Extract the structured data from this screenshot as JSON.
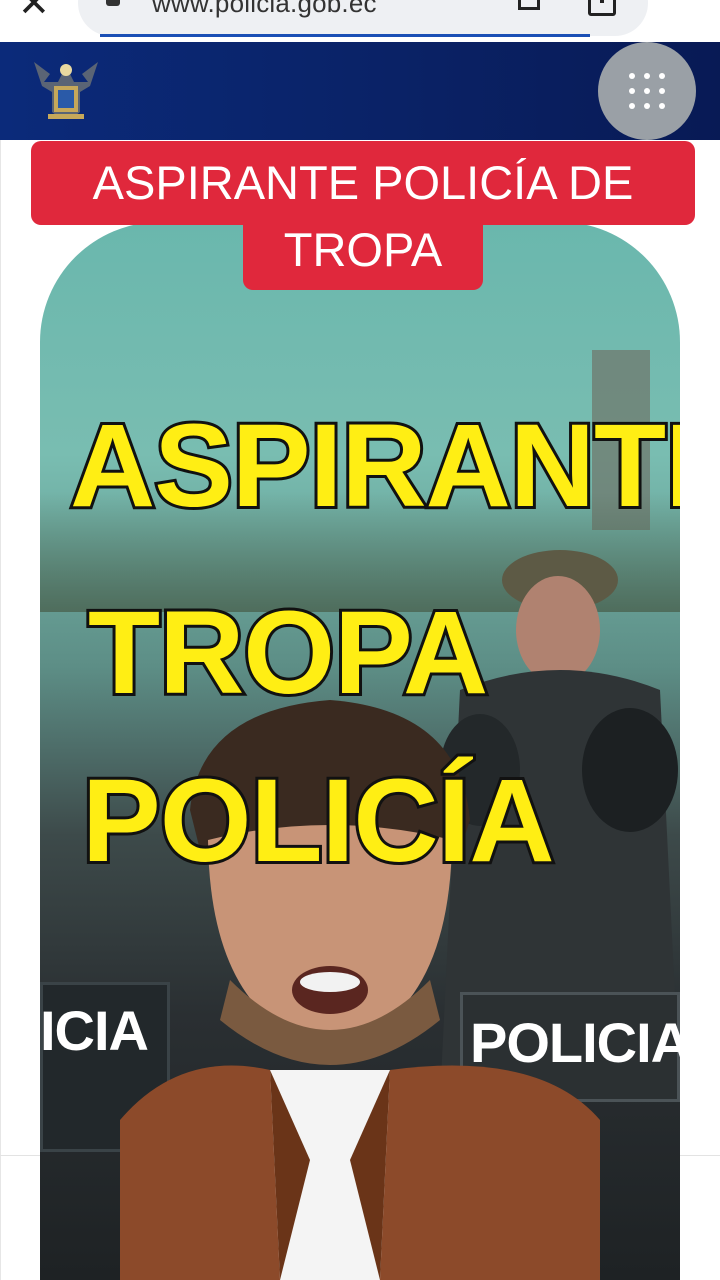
{
  "browser": {
    "url": "www.policia.gob.ec",
    "close_icon": "close-icon",
    "bookmark_icon": "bookmark-icon",
    "share_icon": "share-icon"
  },
  "site": {
    "logo_icon": "police-crest-logo",
    "apps_icon": "apps-grid-icon"
  },
  "caption": {
    "line1": "ASPIRANTE POLICÍA DE",
    "line2": "TROPA"
  },
  "video": {
    "overlay_lines": [
      "ASPIRANTE",
      "TROPA",
      "POLICÍA"
    ],
    "shield_left_text": "ICIA",
    "shield_right_text": "POLICIA"
  },
  "colors": {
    "header_blue": "#0b2a7a",
    "caption_red": "#e0283c",
    "overlay_yellow": "#ffee14"
  }
}
